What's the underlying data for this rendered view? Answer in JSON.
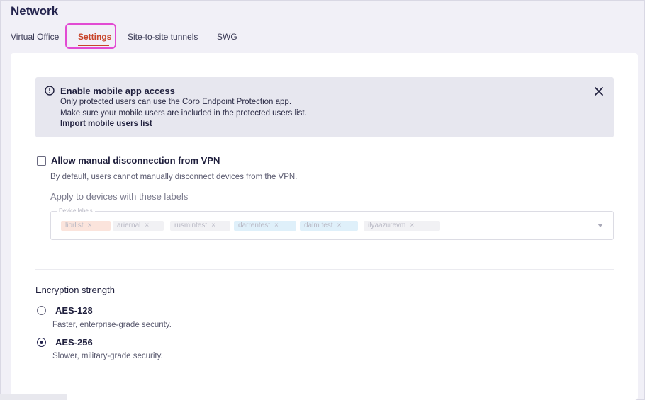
{
  "page": {
    "title": "Network"
  },
  "tabs": [
    {
      "label": "Virtual Office"
    },
    {
      "label": "Settings"
    },
    {
      "label": "Site-to-site tunnels"
    },
    {
      "label": "SWG"
    }
  ],
  "banner": {
    "title": "Enable mobile app access",
    "line1": "Only protected users can use the Coro Endpoint Protection app.",
    "line2": "Make sure your mobile users are included in the protected users list.",
    "link": "Import mobile users list",
    "icon": "info-circle-icon"
  },
  "vpn": {
    "checkbox_label": "Allow manual disconnection from VPN",
    "checked": false,
    "description": "By default, users cannot manually disconnect devices from the VPN.",
    "apply_heading": "Apply to devices with these labels",
    "field_label": "Device labels",
    "chips": [
      {
        "label": "liorlist",
        "color": "#fbe4dc"
      },
      {
        "label": "ariernal",
        "color": "#f1f1f4"
      },
      {
        "label": "rusmintest",
        "color": "#f1f1f4"
      },
      {
        "label": "darrentest",
        "color": "#dff0fa"
      },
      {
        "label": "dalm test",
        "color": "#dff0fa"
      },
      {
        "label": "ilyaazurevm",
        "color": "#f1f1f4"
      }
    ]
  },
  "encryption": {
    "heading": "Encryption strength",
    "selected": "AES-256",
    "options": [
      {
        "label": "AES-128",
        "description": "Faster, enterprise-grade security."
      },
      {
        "label": "AES-256",
        "description": "Slower, military-grade security."
      }
    ]
  },
  "colors": {
    "accent": "#c8442a",
    "highlight": "#e24bd3",
    "banner_bg": "#e7e7ef"
  }
}
